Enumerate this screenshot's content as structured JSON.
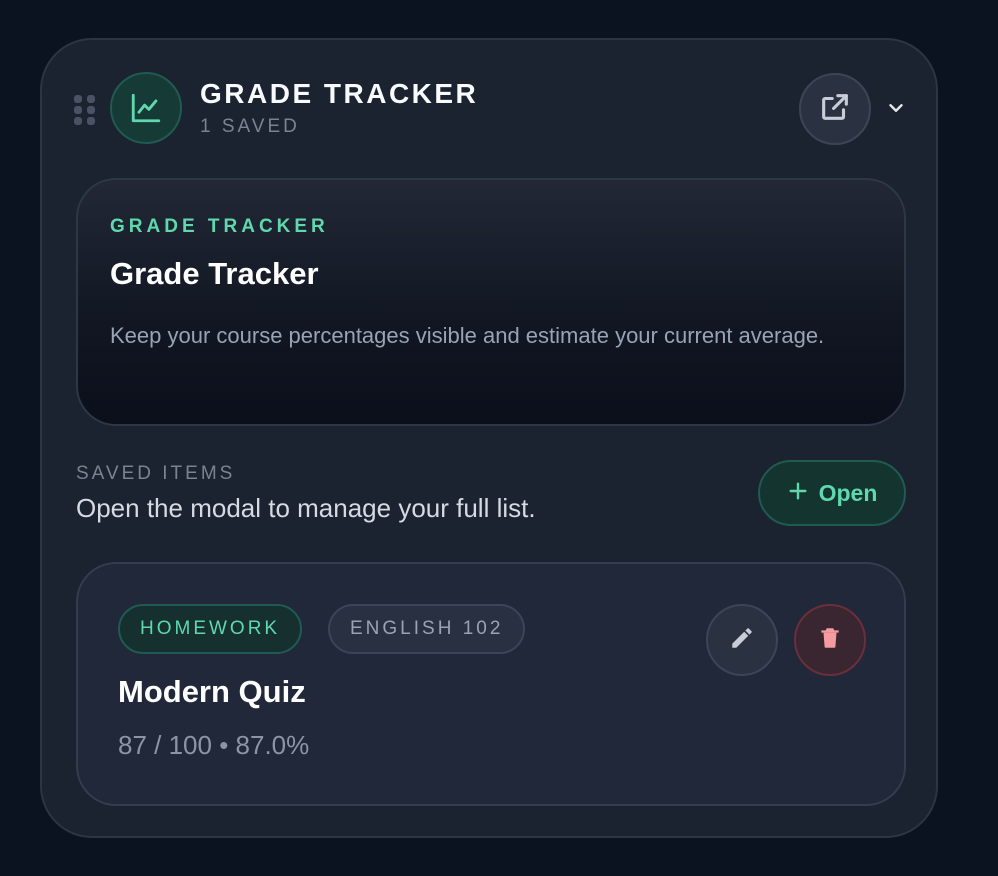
{
  "widget": {
    "title": "GRADE TRACKER",
    "subtitle": "1 SAVED",
    "icons": {
      "drag": "drag-handle-icon",
      "app": "line-chart-icon",
      "external": "external-link-icon",
      "collapse": "chevron-down-icon"
    }
  },
  "intro": {
    "eyebrow": "GRADE TRACKER",
    "title": "Grade Tracker",
    "description": "Keep your course percentages visible and estimate your current average."
  },
  "saved": {
    "label": "SAVED ITEMS",
    "description": "Open the modal to manage your full list.",
    "open_button": {
      "icon": "plus-icon",
      "label": "Open"
    }
  },
  "items": [
    {
      "category": "HOMEWORK",
      "course": "ENGLISH 102",
      "title": "Modern Quiz",
      "score": "87 / 100 • 87.0%",
      "actions": {
        "edit_icon": "pencil-icon",
        "delete_icon": "trash-icon"
      }
    }
  ],
  "colors": {
    "accent": "#5fd8ad",
    "background": "#0b1220",
    "panel": "#1b2230",
    "danger": "#f49aa0"
  }
}
